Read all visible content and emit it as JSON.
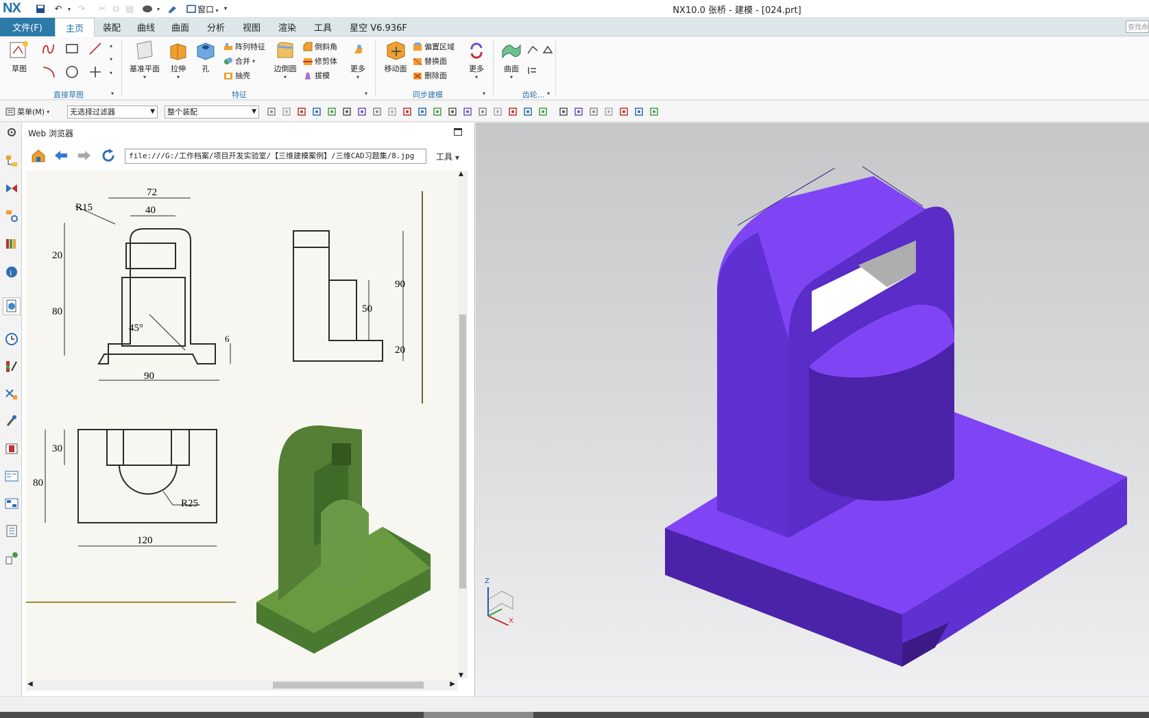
{
  "app": {
    "logo": "NX",
    "title": "NX10.0 张桥 - 建模 - [024.prt]",
    "window_menu": "窗口"
  },
  "menu": {
    "file": "文件(F)",
    "tabs": [
      "主页",
      "装配",
      "曲线",
      "曲面",
      "分析",
      "视图",
      "渲染",
      "工具",
      "星空 V6.936F"
    ],
    "active_tab": "主页",
    "search_placeholder": "查找命"
  },
  "ribbon": {
    "sketch": "草图",
    "group_direct_sketch": "直接草图",
    "datum_plane": "基准平面",
    "extrude": "拉伸",
    "hole": "孔",
    "pattern_feature": "阵列特征",
    "combine": "合并",
    "shell": "抽壳",
    "edge_blend": "边倒圆",
    "chamfer": "倒斜角",
    "trim_body": "修剪体",
    "draft": "拔模",
    "more_feature": "更多",
    "group_feature": "特征",
    "move_face": "移动面",
    "offset_region": "偏置区域",
    "replace_face": "替换面",
    "delete_face": "删除面",
    "more_sync": "更多",
    "group_sync": "同步建模",
    "surface": "曲面",
    "group_gear": "齿轮..."
  },
  "toolbar": {
    "menu_label": "菜单(M)",
    "filter_value": "无选择过滤器",
    "assembly_value": "整个装配"
  },
  "web_browser": {
    "title": "Web 浏览器",
    "url": "file:///G:/工作档案/项目开发实验室/【三维建模案例】/三维CAD习题集/8.jpg",
    "tools": "工具"
  },
  "drawing": {
    "dim_72": "72",
    "dim_40": "40",
    "dim_r15": "R15",
    "dim_20a": "20",
    "dim_80a": "80",
    "dim_45": "45°",
    "dim_6": "6",
    "dim_90a": "90",
    "dim_90b": "90",
    "dim_50": "50",
    "dim_20b": "20",
    "dim_30": "30",
    "dim_80b": "80",
    "dim_r25": "R25",
    "dim_120": "120"
  },
  "viewport": {
    "triad_z": "Z",
    "triad_x": "X"
  },
  "colors": {
    "model_top": "#7f45f5",
    "model_front": "#4b23a8",
    "model_side": "#5f30d2",
    "drawing_model": "#5d8a3a",
    "accent": "#2c7aa8"
  }
}
